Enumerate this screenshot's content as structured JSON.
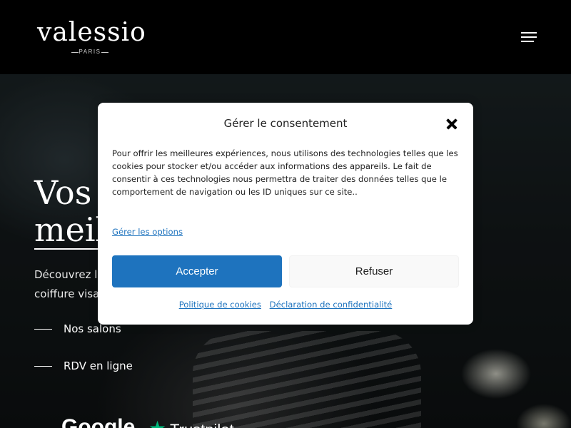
{
  "header": {
    "logo_word": "valessio",
    "logo_city": "PARIS",
    "menu_icon": "hamburger-menu-icon"
  },
  "hero": {
    "title_line1": "Vos",
    "title_line2": "meil",
    "desc_line1": "Découvrez le",
    "desc_line2": "coiffure visa",
    "links": [
      {
        "label": "Nos salons"
      },
      {
        "label": "RDV en ligne"
      }
    ],
    "bottom_brand": "Google",
    "trustpilot_label": "Trustpilot",
    "trustpilot_icon": "star-icon"
  },
  "consent": {
    "title": "Gérer le consentement",
    "close_icon": "close-icon",
    "body": "Pour offrir les meilleures expériences, nous utilisons des technologies telles que les cookies pour stocker et/ou accéder aux informations des appareils. Le fait de consentir à ces technologies nous permettra de traiter des données telles que le comportement de navigation ou les ID uniques sur ce site..",
    "manage_options": "Gérer les options",
    "accept_label": "Accepter",
    "refuse_label": "Refuser",
    "cookie_policy": "Politique de cookies",
    "privacy_statement": "Déclaration de confidentialité"
  },
  "colors": {
    "accent": "#1e73be",
    "header_bg": "#000000",
    "trustpilot_green": "#00b67a"
  }
}
